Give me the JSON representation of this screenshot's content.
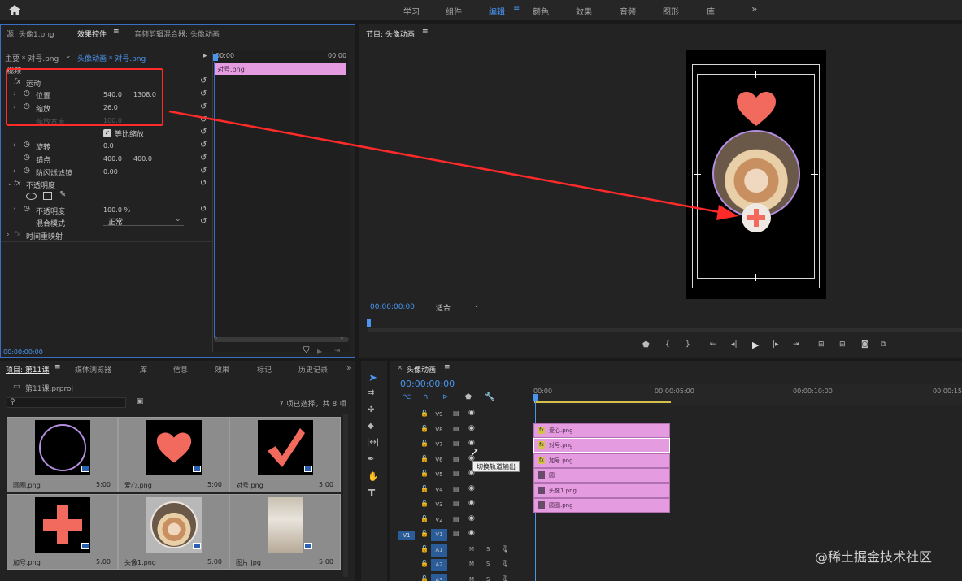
{
  "workspaces": [
    "学习",
    "组件",
    "编辑",
    "颜色",
    "效果",
    "音频",
    "图形",
    "库"
  ],
  "workspace_active": "编辑",
  "effect_controls": {
    "tab_source": "源: 头像1.png",
    "tab_effects": "效果控件",
    "tab_mixer": "音频剪辑混合器: 头像动画",
    "master_label": "主要 * 对号.png",
    "sequence_label": "头像动画 * 对号.png",
    "section_video": "视频",
    "time_start": "00:00",
    "time_end": "00:00",
    "clip_name": "对号.png",
    "motion": "运动",
    "position": "位置",
    "position_x": "540.0",
    "position_y": "1308.0",
    "scale": "缩放",
    "scale_value": "26.0",
    "scale_width": "缩放宽度",
    "scale_width_value": "100.0",
    "uniform_scale": "等比缩放",
    "rotation": "旋转",
    "rotation_value": "0.0",
    "anchor": "锚点",
    "anchor_x": "400.0",
    "anchor_y": "400.0",
    "anti_flicker": "防闪烁滤镜",
    "anti_flicker_value": "0.00",
    "opacity_section": "不透明度",
    "opacity": "不透明度",
    "opacity_value": "100.0 %",
    "blend_mode": "混合模式",
    "blend_value": "正常",
    "time_remap": "时间重映射",
    "bottom_time": "00:00:00:00"
  },
  "program": {
    "title": "节目: 头像动画",
    "timecode": "00:00:00:00",
    "fit": "适合"
  },
  "project": {
    "tabs": [
      "项目: 第11课",
      "媒体浏览器",
      "库",
      "信息",
      "效果",
      "标记",
      "历史记录"
    ],
    "file": "第11课.prproj",
    "selection_status": "7 项已选择，共 8 项",
    "items": [
      {
        "name": "圆圈.png",
        "duration": "5:00",
        "kind": "ring"
      },
      {
        "name": "爱心.png",
        "duration": "5:00",
        "kind": "heart"
      },
      {
        "name": "对号.png",
        "duration": "5:00",
        "kind": "check"
      },
      {
        "name": "加号.png",
        "duration": "5:00",
        "kind": "plus"
      },
      {
        "name": "头像1.png",
        "duration": "5:00",
        "kind": "avatar"
      },
      {
        "name": "图片.jpg",
        "duration": "5:00",
        "kind": "photo"
      }
    ]
  },
  "timeline": {
    "title": "头像动画",
    "timecode": "00:00:00:00",
    "ruler": [
      "00:00",
      "00:00:05:00",
      "00:00:10:00",
      "00:00:15:0"
    ],
    "tracks_video": [
      "V9",
      "V8",
      "V7",
      "V6",
      "V5",
      "V4",
      "V3",
      "V2",
      "V1"
    ],
    "tracks_audio": [
      "A1",
      "A2",
      "A3"
    ],
    "source_v": "V1",
    "clips": [
      {
        "track": "V8",
        "name": "爱心.png",
        "fx": true
      },
      {
        "track": "V7",
        "name": "对号.png",
        "fx": true
      },
      {
        "track": "V6",
        "name": "加号.png",
        "fx": true
      },
      {
        "track": "V5",
        "name": "圆",
        "fx": false
      },
      {
        "track": "V4",
        "name": "头像1.png",
        "fx": false
      },
      {
        "track": "V3",
        "name": "圆圈.png",
        "fx": false
      }
    ],
    "tooltip": "切换轨道输出"
  },
  "watermark": "@稀土掘金技术社区",
  "colors": {
    "accent": "#4a95ef",
    "clip": "#e59be0",
    "annotation": "#ff2a2a",
    "heart": "#f26a5d"
  }
}
